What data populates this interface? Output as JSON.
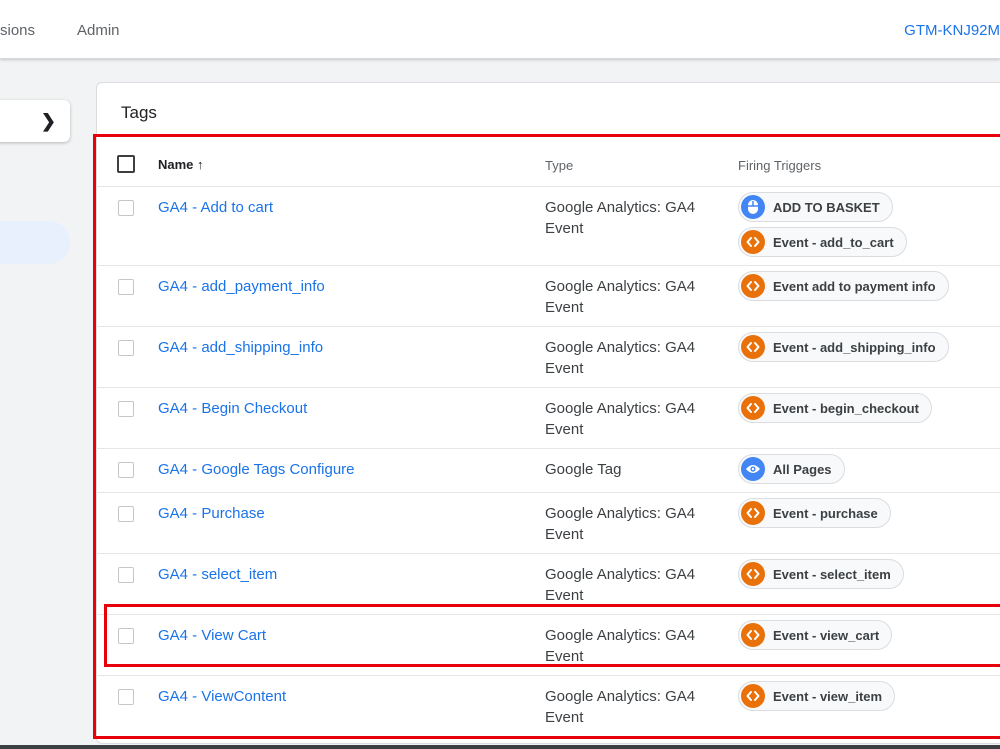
{
  "header": {
    "tabs": [
      {
        "label": "sions"
      },
      {
        "label": "Admin"
      }
    ],
    "container_id": "GTM-KNJ92M"
  },
  "sidebar": {
    "expand_icon": "chevron-right-icon"
  },
  "card": {
    "title": "Tags"
  },
  "table": {
    "columns": {
      "name": "Name ↑",
      "type": "Type",
      "triggers": "Firing Triggers"
    },
    "rows": [
      {
        "name": "GA4 - Add to cart",
        "type": "Google Analytics: GA4 Event",
        "triggers": [
          {
            "label": "ADD TO BASKET",
            "icon": "click-icon",
            "color": "#4285f4"
          },
          {
            "label": "Event - add_to_cart",
            "icon": "code-icon",
            "color": "#e8710a"
          }
        ]
      },
      {
        "name": "GA4 - add_payment_info",
        "type": "Google Analytics: GA4 Event",
        "triggers": [
          {
            "label": "Event add to payment info",
            "icon": "code-icon",
            "color": "#e8710a"
          }
        ]
      },
      {
        "name": "GA4 - add_shipping_info",
        "type": "Google Analytics: GA4 Event",
        "triggers": [
          {
            "label": "Event - add_shipping_info",
            "icon": "code-icon",
            "color": "#e8710a"
          }
        ]
      },
      {
        "name": "GA4 - Begin Checkout",
        "type": "Google Analytics: GA4 Event",
        "triggers": [
          {
            "label": "Event - begin_checkout",
            "icon": "code-icon",
            "color": "#e8710a"
          }
        ]
      },
      {
        "name": "GA4 - Google Tags Configure",
        "type": "Google Tag",
        "triggers": [
          {
            "label": "All Pages",
            "icon": "eye-icon",
            "color": "#4285f4"
          }
        ]
      },
      {
        "name": "GA4 - Purchase",
        "type": "Google Analytics: GA4 Event",
        "triggers": [
          {
            "label": "Event - purchase",
            "icon": "code-icon",
            "color": "#e8710a"
          }
        ]
      },
      {
        "name": "GA4 - select_item",
        "type": "Google Analytics: GA4 Event",
        "triggers": [
          {
            "label": "Event - select_item",
            "icon": "code-icon",
            "color": "#e8710a"
          }
        ]
      },
      {
        "name": "GA4 - View Cart",
        "type": "Google Analytics: GA4 Event",
        "triggers": [
          {
            "label": "Event - view_cart",
            "icon": "code-icon",
            "color": "#e8710a"
          }
        ]
      },
      {
        "name": "GA4 - ViewContent",
        "type": "Google Analytics: GA4 Event",
        "triggers": [
          {
            "label": "Event - view_item",
            "icon": "code-icon",
            "color": "#e8710a"
          }
        ]
      }
    ]
  },
  "colors": {
    "link": "#1a73e8",
    "highlight_border": "#e8000b",
    "custom_event": "#e8710a",
    "page_view": "#4285f4"
  }
}
